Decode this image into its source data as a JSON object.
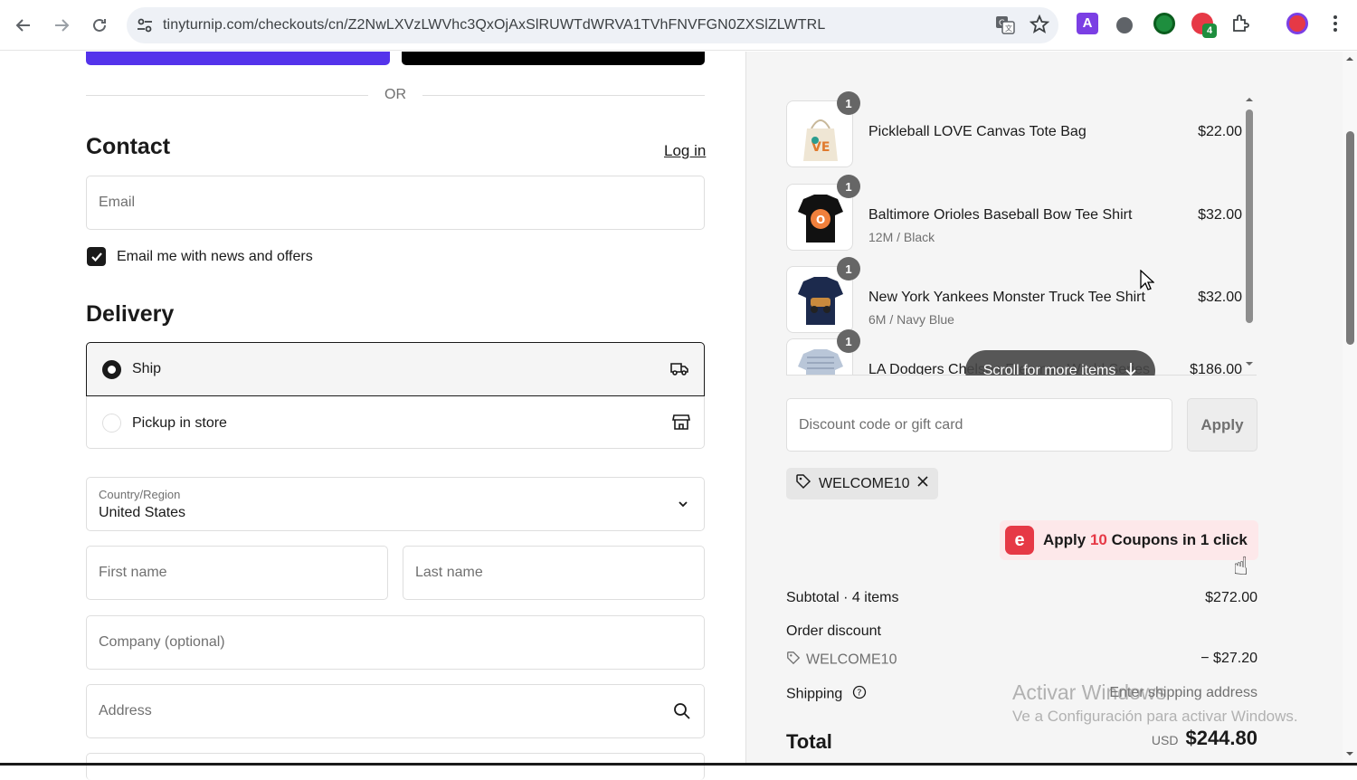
{
  "browser": {
    "url": "tinyturnip.com/checkouts/cn/Z2NwLXVzLWVhc3QxOjAxSlRUWTdWRVA1TVhFNVFGN0ZXSlZLWTRL",
    "icons": [
      "back-icon",
      "forward-icon",
      "reload-icon",
      "site-settings-icon",
      "translate-icon",
      "bookmark-star-icon",
      "extensions-icon",
      "menu-kebab-icon"
    ],
    "extension_badge": "4"
  },
  "checkout": {
    "or_label": "OR",
    "contact_heading": "Contact",
    "login_link": "Log in",
    "email_placeholder": "Email",
    "news_checkbox_label": "Email me with news and offers",
    "delivery_heading": "Delivery",
    "delivery_options": [
      {
        "label": "Ship",
        "selected": true
      },
      {
        "label": "Pickup in store",
        "selected": false
      }
    ],
    "country_label": "Country/Region",
    "country_value": "United States",
    "first_name_placeholder": "First name",
    "last_name_placeholder": "Last name",
    "company_placeholder": "Company (optional)",
    "address_placeholder": "Address"
  },
  "summary": {
    "items": [
      {
        "qty": "1",
        "name": "Pickleball LOVE Canvas Tote Bag",
        "variant": "",
        "price": "$22.00"
      },
      {
        "qty": "1",
        "name": "Baltimore Orioles Baseball Bow Tee Shirt",
        "variant": "12M / Black",
        "price": "$32.00"
      },
      {
        "qty": "1",
        "name": "New York Yankees Monster Truck Tee Shirt",
        "variant": "6M / Navy Blue",
        "price": "$32.00"
      },
      {
        "qty": "1",
        "name": "LA Dodgers Chelsea Freeman World Series",
        "variant": "",
        "price": "$186.00"
      }
    ],
    "scroll_hint": "Scroll for more items",
    "discount_placeholder": "Discount code or gift card",
    "apply_label": "Apply",
    "applied_code": "WELCOME10",
    "coupon_banner": {
      "prefix": "Apply",
      "count": "10",
      "suffix": "Coupons in 1 click"
    },
    "subtotal_label": "Subtotal · 4 items",
    "subtotal_value": "$272.00",
    "order_discount_label": "Order discount",
    "discount_code": "WELCOME10",
    "discount_value": "− $27.20",
    "shipping_label": "Shipping",
    "shipping_value": "Enter shipping address",
    "total_label": "Total",
    "total_currency": "USD",
    "total_value": "$244.80"
  },
  "watermark": {
    "line1": "Activar Windows",
    "line2": "Ve a Configuración para activar Windows."
  },
  "colors": {
    "shop_pay": "#5433eb",
    "coupon_red": "#e63946"
  }
}
